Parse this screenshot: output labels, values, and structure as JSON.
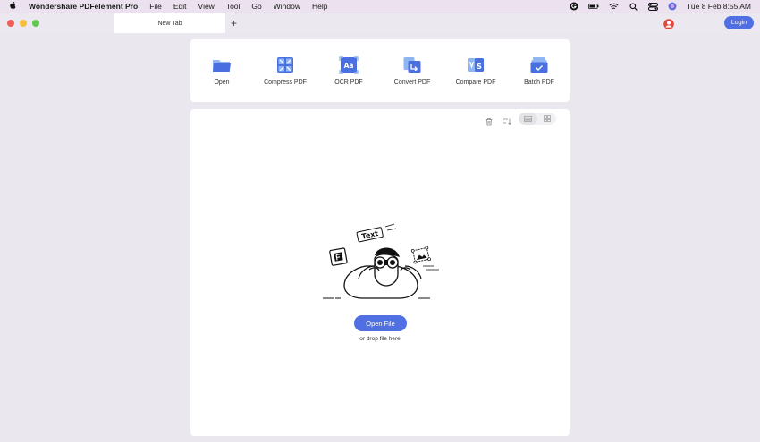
{
  "menubar": {
    "app_name": "Wondershare PDFelement Pro",
    "items": [
      "File",
      "Edit",
      "View",
      "Tool",
      "Go",
      "Window",
      "Help"
    ],
    "clock": "Tue 8 Feb  8:55 AM"
  },
  "window": {
    "tab_title": "New Tab",
    "new_tab": "+",
    "login": "Login"
  },
  "tools": [
    {
      "label": "Open",
      "icon": "folder-icon"
    },
    {
      "label": "Compress PDF",
      "icon": "compress-icon"
    },
    {
      "label": "OCR PDF",
      "icon": "ocr-icon"
    },
    {
      "label": "Convert PDF",
      "icon": "convert-icon"
    },
    {
      "label": "Compare PDF",
      "icon": "compare-icon"
    },
    {
      "label": "Batch PDF",
      "icon": "batch-icon"
    }
  ],
  "empty_state": {
    "illustration_text": "Text",
    "open_button": "Open File",
    "drop_hint": "or drop file here"
  },
  "colors": {
    "accent": "#4f6fe3",
    "tool_icon": "#4a6fe0",
    "tool_icon_light": "#8fb5f2"
  }
}
